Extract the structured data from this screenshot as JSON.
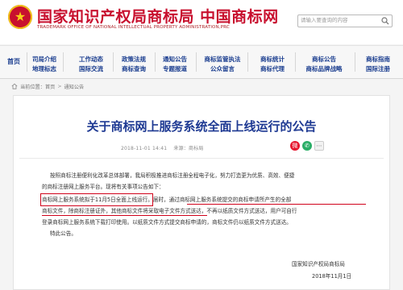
{
  "header": {
    "title": "国家知识产权局商标局 中国商标网",
    "subtitle": "TRADEMARK OFFICE OF NATIONAL INTELLECTUAL PROPERTY ADMINISTRATION,PRC",
    "search_placeholder": "请输入要查询的内容",
    "brand_color": "#c8102e"
  },
  "nav": {
    "home": "首页",
    "columns": [
      {
        "top": "司局介绍",
        "bottom": "地理标志"
      },
      {
        "top": "工作动态",
        "bottom": "国际交流"
      },
      {
        "top": "政策法规",
        "bottom": "商标查询"
      },
      {
        "top": "通知公告",
        "bottom": "专题报道"
      },
      {
        "top": "商标监管执法",
        "bottom": "公众留言"
      },
      {
        "top": "商标统计",
        "bottom": "商标代理"
      },
      {
        "top": "商标公告",
        "bottom": "商标品牌战略"
      },
      {
        "top": "商标指南",
        "bottom": "国际注册"
      }
    ]
  },
  "breadcrumb": {
    "label": "当前位置：",
    "items": [
      "首页",
      "通知公告"
    ]
  },
  "article": {
    "title": "关于商标网上服务系统全面上线运行的公告",
    "date": "2018-11-01 14:41",
    "source": "来源：商标局",
    "p1_l1": "按照商标注册便利化改革总体部署，我局积极推进商标注册全程电子化，努力打造更为优质、高效、便捷",
    "p1_l2": "的商标注册网上服务平台。现将有关事项公告如下：",
    "p2_a": "商标网上服务系统拟于11月5日全面上线运行",
    "p2_b": "。届时，",
    "p2_c": "通过商标网上服务系统提交的商标申请所产生的全部",
    "p2_l2_a": "商标文件，除商标注册证外，其他商标文件将采取电子文件方式送达",
    "p2_l2_b": "，不再以纸质文件方式送达，用户可自行",
    "p2_l3": "登录商标网上服务系统下载打印使用。以纸质文件方式提交商标申请的，商标文件仍以纸质文件方式送达。",
    "p3": "特此公告。",
    "sign_org": "国家知识产权局商标局",
    "sign_date": "2018年11月1日"
  },
  "share": {
    "icons": [
      "weibo-icon",
      "wechat-icon",
      "more-icon"
    ]
  }
}
